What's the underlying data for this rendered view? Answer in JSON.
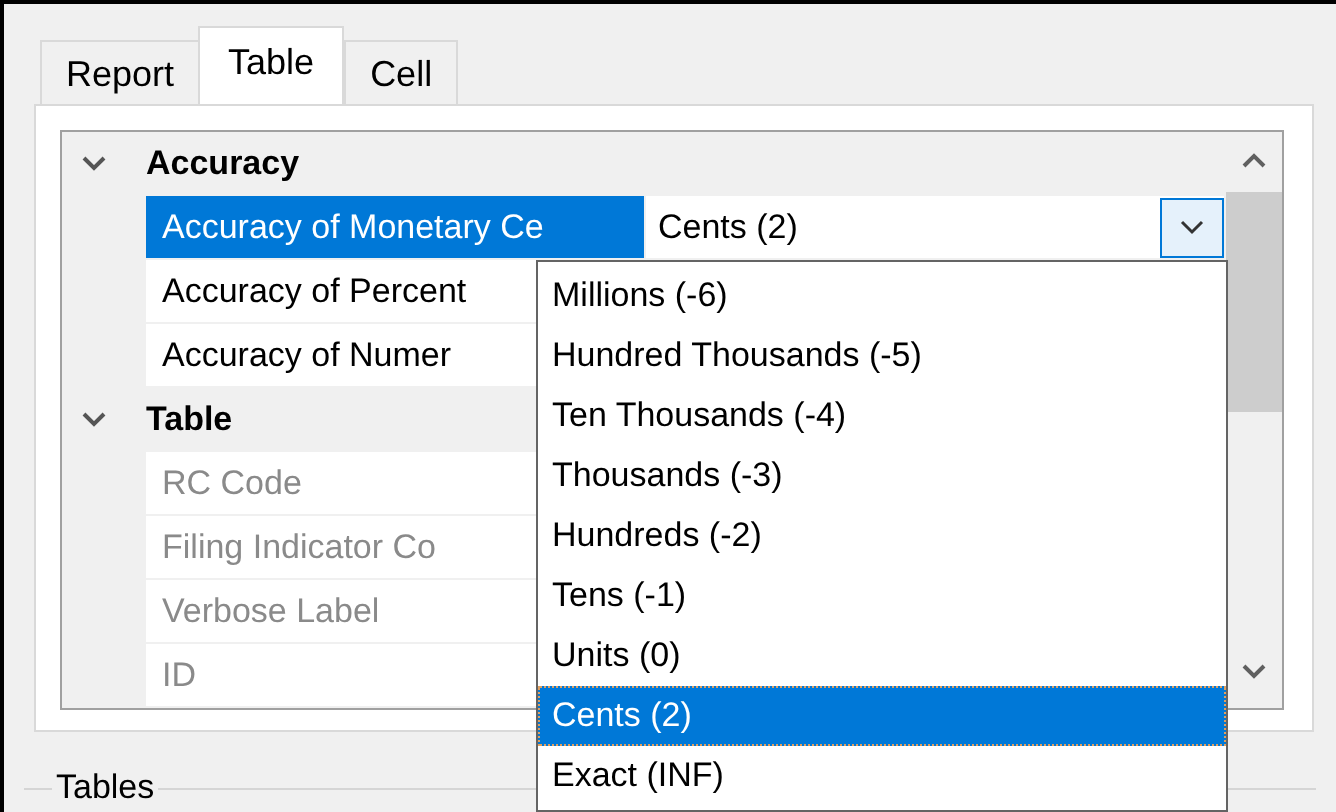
{
  "tabs": [
    {
      "label": "Report",
      "selected": false
    },
    {
      "label": "Table",
      "selected": true
    },
    {
      "label": "Cell",
      "selected": false
    }
  ],
  "property_grid": {
    "categories": [
      {
        "name": "Accuracy",
        "expanded": true,
        "properties": [
          {
            "name": "Accuracy of Monetary Ce",
            "value": "Cents (2)",
            "selected": true,
            "disabled": false
          },
          {
            "name": "Accuracy of Percent",
            "selected": false,
            "disabled": false
          },
          {
            "name": "Accuracy of Numer",
            "selected": false,
            "disabled": false
          }
        ]
      },
      {
        "name": "Table",
        "expanded": true,
        "properties": [
          {
            "name": "RC Code",
            "selected": false,
            "disabled": true
          },
          {
            "name": "Filing Indicator Co",
            "selected": false,
            "disabled": true
          },
          {
            "name": "Verbose Label",
            "selected": false,
            "disabled": true
          },
          {
            "name": "ID",
            "selected": false,
            "disabled": true
          }
        ]
      }
    ]
  },
  "dropdown": {
    "items": [
      {
        "label": "Millions (-6)",
        "selected": false
      },
      {
        "label": "Hundred Thousands (-5)",
        "selected": false
      },
      {
        "label": "Ten Thousands (-4)",
        "selected": false
      },
      {
        "label": "Thousands (-3)",
        "selected": false
      },
      {
        "label": "Hundreds (-2)",
        "selected": false
      },
      {
        "label": "Tens (-1)",
        "selected": false
      },
      {
        "label": "Units (0)",
        "selected": false
      },
      {
        "label": "Cents (2)",
        "selected": true
      },
      {
        "label": "Exact (INF)",
        "selected": false
      }
    ]
  },
  "group_box": {
    "title": "Tables"
  }
}
